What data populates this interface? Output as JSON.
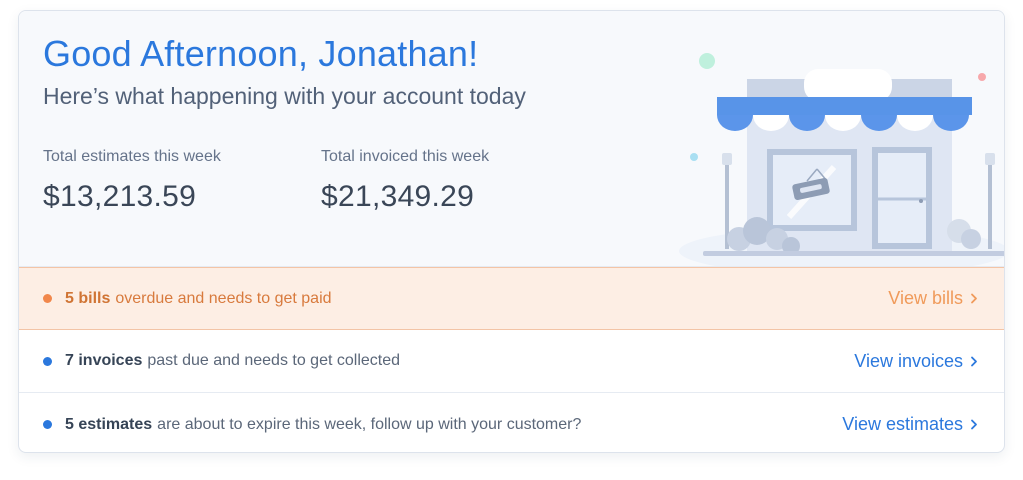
{
  "header": {
    "greeting": "Good Afternoon, Jonathan!",
    "subtitle": "Here’s what happening with your account today"
  },
  "stats": {
    "estimates": {
      "label": "Total estimates this week",
      "value": "$13,213.59"
    },
    "invoiced": {
      "label": "Total invoiced this week",
      "value": "$21,349.29"
    }
  },
  "alerts": [
    {
      "count": "5 bills",
      "text": "overdue and needs to get paid",
      "link": "View bills",
      "status": "overdue",
      "accent": "#f1874b"
    },
    {
      "count": "7 invoices",
      "text": "past due and needs to get collected",
      "link": "View invoices",
      "status": "info",
      "accent": "#2b78dd"
    },
    {
      "count": "5 estimates",
      "text": "are about to expire this week, follow up with your customer?",
      "link": "View estimates",
      "status": "info",
      "accent": "#2b78dd"
    }
  ],
  "icons": {
    "illustration": "storefront-illustration",
    "link_chevron": "chevron-right-icon"
  },
  "colors": {
    "brand_blue": "#2b78dd",
    "overdue_orange": "#f1874b",
    "overdue_bg": "#fdeee4"
  }
}
